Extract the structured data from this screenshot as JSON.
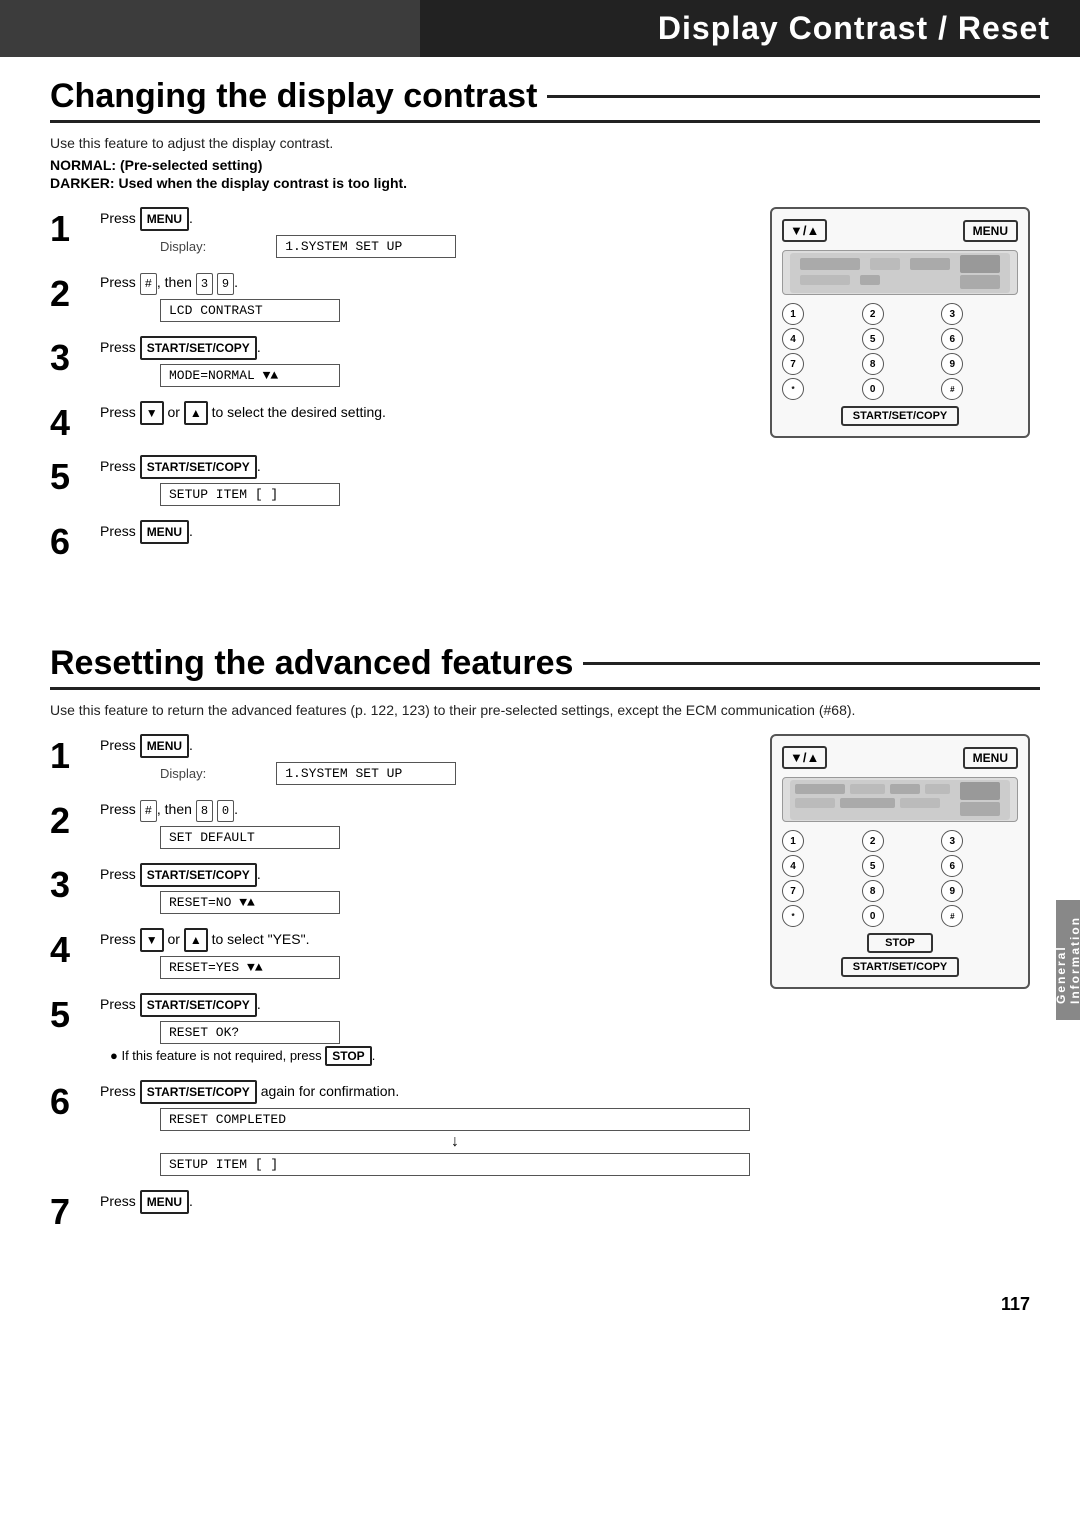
{
  "header": {
    "title": "Display Contrast / Reset",
    "bg_text": ""
  },
  "section1": {
    "title": "Changing the display contrast",
    "intro1": "Use this feature to adjust the display contrast.",
    "intro2_label": "NORMAL:",
    "intro2_text": " (Pre-selected setting)",
    "intro3_label": "DARKER:",
    "intro3_text": " Used when the display contrast is too light.",
    "steps": [
      {
        "num": "1",
        "text": "Press [MENU].",
        "display_label": "Display:",
        "display_value": "1.SYSTEM SET UP"
      },
      {
        "num": "2",
        "text": "Press [#], then [3][9].",
        "display_value": "LCD CONTRAST"
      },
      {
        "num": "3",
        "text": "Press [START/SET/COPY].",
        "display_value": "MODE=NORMAL ▼▲"
      },
      {
        "num": "4",
        "text": "Press [▼] or [▲] to select the desired setting.",
        "display_value": null
      },
      {
        "num": "5",
        "text": "Press [START/SET/COPY].",
        "display_value": "SETUP ITEM [   ]"
      },
      {
        "num": "6",
        "text": "Press [MENU].",
        "display_value": null
      }
    ]
  },
  "section2": {
    "title": "Resetting the advanced features",
    "intro": "Use this feature to return the advanced features (p. 122, 123) to their pre-selected settings, except the ECM communication (#68).",
    "steps": [
      {
        "num": "1",
        "text": "Press [MENU].",
        "display_label": "Display:",
        "display_value": "1.SYSTEM SET UP"
      },
      {
        "num": "2",
        "text": "Press [#], then [8][0].",
        "display_value": "SET DEFAULT"
      },
      {
        "num": "3",
        "text": "Press [START/SET/COPY].",
        "display_value": "RESET=NO ▼▲"
      },
      {
        "num": "4",
        "text": "Press [▼] or [▲] to select \"YES\".",
        "display_value": "RESET=YES ▼▲"
      },
      {
        "num": "5",
        "text": "Press [START/SET/COPY].",
        "display_value": "RESET OK?",
        "bullet": "If this feature is not required, press [STOP]."
      },
      {
        "num": "6",
        "text": "Press [START/SET/COPY] again for confirmation.",
        "display_value": "RESET COMPLETED",
        "display_value2": "SETUP ITEM [   ]"
      },
      {
        "num": "7",
        "text": "Press [MENU].",
        "display_value": null
      }
    ]
  },
  "device1": {
    "arrows_label": "▼/▲",
    "menu_label": "MENU",
    "keys": [
      "1",
      "2",
      "3",
      "4",
      "5",
      "6",
      "7",
      "8",
      "9",
      "*",
      "0",
      "#"
    ],
    "start_label": "START/SET/COPY"
  },
  "device2": {
    "arrows_label": "▼/▲",
    "menu_label": "MENU",
    "keys": [
      "1",
      "2",
      "3",
      "4",
      "5",
      "6",
      "7",
      "8",
      "9",
      "*",
      "0",
      "#"
    ],
    "stop_label": "STOP",
    "start_label": "START/SET/COPY"
  },
  "sidebar": {
    "label": "General Information"
  },
  "page_number": "117"
}
